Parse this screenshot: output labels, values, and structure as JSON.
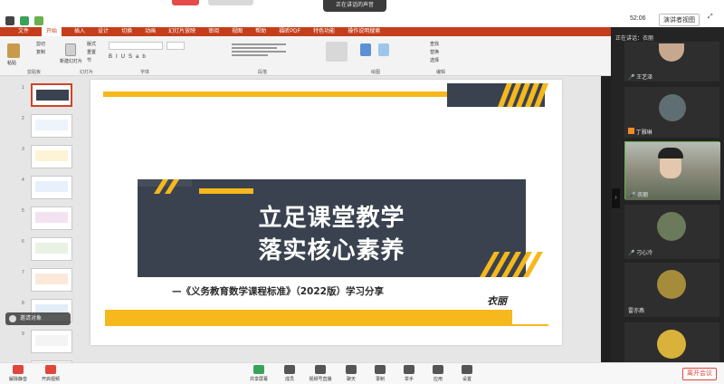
{
  "meeting": {
    "speaking_label": "正在讲话的声音",
    "timer": "52:06",
    "view_label": "演讲者视图",
    "leave_label": "离开会议",
    "gallery_title": "正在讲话：衣丽"
  },
  "ppt": {
    "tabs": [
      "文件",
      "开始",
      "插入",
      "设计",
      "切换",
      "动画",
      "幻灯片放映",
      "审阅",
      "视图",
      "帮助",
      "福昕PDF",
      "特色功能",
      "操作说明搜索"
    ],
    "active_tab": "开始",
    "groups": [
      "剪贴板",
      "幻灯片",
      "字体",
      "段落",
      "绘图",
      "编辑"
    ],
    "buttons": {
      "paste": "粘贴",
      "cut": "剪切",
      "copy": "复制",
      "new_slide": "新建幻灯片",
      "layout": "版式",
      "reset": "重置",
      "section": "节",
      "find": "查找",
      "replace": "替换",
      "select": "选择"
    },
    "thumb_numbers": [
      "1",
      "2",
      "3",
      "4",
      "5",
      "6",
      "7",
      "8",
      "9",
      "10"
    ]
  },
  "slide": {
    "title_line1": "立足课堂教学",
    "title_line2": "落实核心素养",
    "subtitle": "—《义务教育数学课程标准》（2022版）学习分享",
    "signature": "衣丽",
    "colors": {
      "dark": "#3a4250",
      "accent": "#f6b81c"
    }
  },
  "participants": [
    {
      "name": "王艺泽"
    },
    {
      "name": "丁雅琳"
    },
    {
      "name": "衣丽"
    },
    {
      "name": "刁心冷"
    },
    {
      "name": "雷亦燕"
    },
    {
      "name": ""
    }
  ],
  "bottombar": {
    "items": [
      "解除静音",
      "开启视频",
      "共享屏幕",
      "成员",
      "视频号直播",
      "聊天",
      "录制",
      "举手",
      "应用",
      "设置"
    ],
    "float_chat": "邀请对象"
  }
}
